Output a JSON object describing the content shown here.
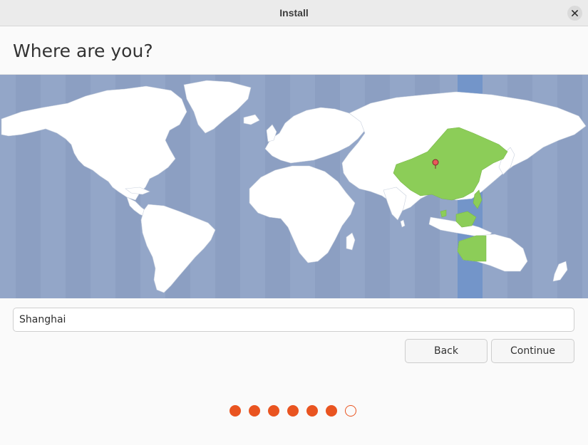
{
  "window": {
    "title": "Install"
  },
  "page": {
    "heading": "Where are you?"
  },
  "map": {
    "icon": "world-timezone-map",
    "selected_marker": "location-pin-icon",
    "colors": {
      "ocean": "#93a6c8",
      "land": "#ffffff",
      "selected_zone_land": "#8ccd58",
      "selected_zone_band": "#7395c9"
    }
  },
  "location": {
    "value": "Shanghai",
    "placeholder": ""
  },
  "buttons": {
    "back_label": "Back",
    "continue_label": "Continue"
  },
  "progress": {
    "total_steps": 7,
    "completed_steps": 6,
    "color": "#e95420"
  }
}
